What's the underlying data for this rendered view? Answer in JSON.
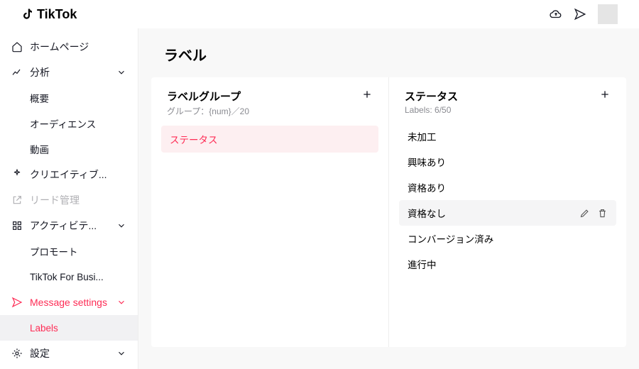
{
  "brand": {
    "name": "TikTok"
  },
  "page": {
    "title": "ラベル"
  },
  "sidebar": {
    "home": "ホームページ",
    "analytics": "分析",
    "analytics_overview": "概要",
    "analytics_audience": "オーディエンス",
    "analytics_video": "動画",
    "creative": "クリエイティブ...",
    "leads": "リード管理",
    "activity": "アクティビテ...",
    "activity_promote": "プロモート",
    "activity_tt4b": "TikTok For Busi...",
    "msg_settings": "Message settings",
    "labels": "Labels",
    "settings": "設定"
  },
  "groups": {
    "panel_title": "ラベルグループ",
    "panel_sub": "グループ：{num}／20",
    "items": [
      {
        "name": "ステータス",
        "selected": true
      }
    ]
  },
  "labels": {
    "panel_title": "ステータス",
    "panel_sub": "Labels: 6/50",
    "items": [
      {
        "name": "未加工"
      },
      {
        "name": "興味あり"
      },
      {
        "name": "資格あり"
      },
      {
        "name": "資格なし",
        "hover": true
      },
      {
        "name": "コンバージョン済み"
      },
      {
        "name": "進行中"
      }
    ]
  }
}
